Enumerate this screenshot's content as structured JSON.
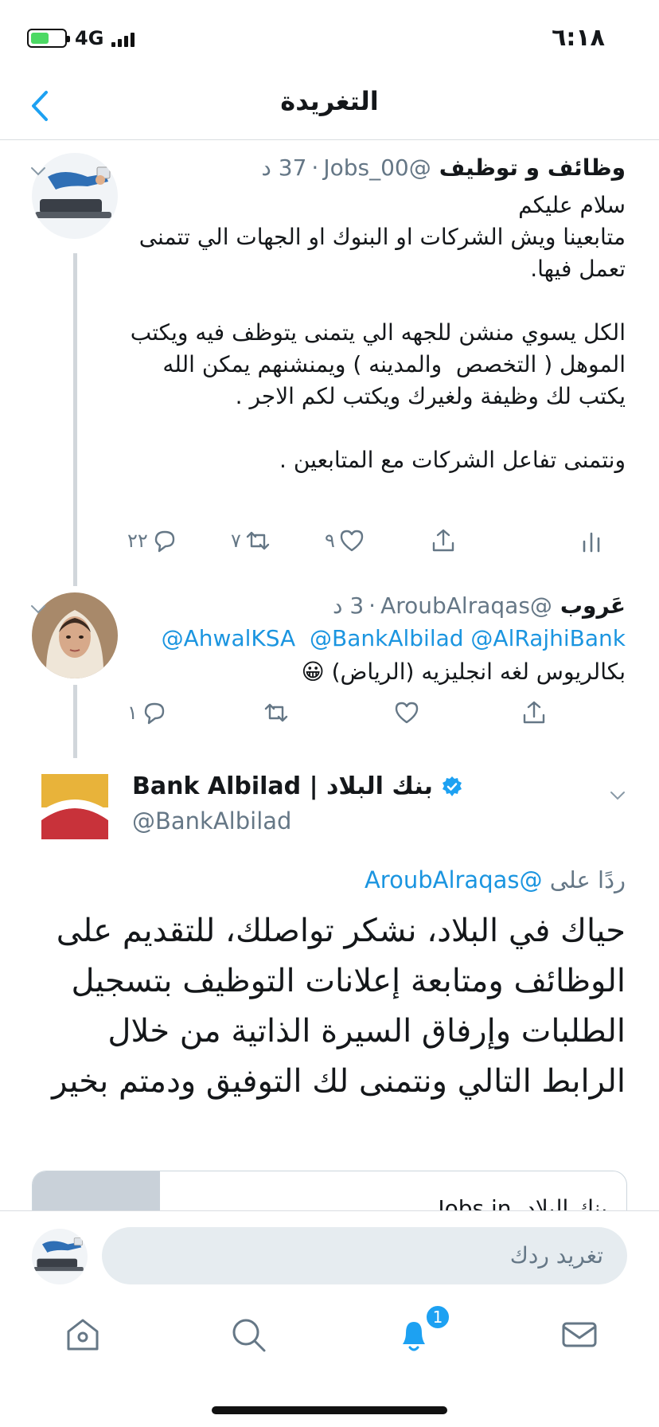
{
  "status_bar": {
    "time": "٦:١٨",
    "network": "4G",
    "battery_level": 0.55,
    "battery_color": "#4cd964"
  },
  "nav": {
    "title": "التغريدة",
    "back_icon": "chevron-left-icon",
    "accent": "#1da1f2"
  },
  "thread": [
    {
      "name": "وظائف و توظيف",
      "handle": "@Jobs_00",
      "time": "37 د",
      "text": "سلام عليكم\nمتابعينا ويش الشركات او البنوك او الجهات الي تتمنى تعمل فيها.\n\nالكل يسوي منشن للجهه الي يتمنى يتوظف فيه ويكتب الموهل ( التخصص  والمدينه ) ويمنشنهم يمكن الله يكتب لك وظيفة ولغيرك ويكتب لكم الاجر .\n\nونتمنى تفاعل الشركات مع المتابعين .",
      "replies": "٢٢",
      "retweets": "٧",
      "likes": "٩"
    },
    {
      "name": "عَروب",
      "handle": "@AroubAlraqas",
      "time": "3 د",
      "mentions": "@AhwalKSA  @BankAlbilad @AlRajhiBank",
      "text": "بكالريوس لغه انجليزيه (الرياض) 😀",
      "replies": "١",
      "retweets": "",
      "likes": ""
    }
  ],
  "main_tweet": {
    "name": "Bank Albilad | بنك البلاد",
    "handle": "@BankAlbilad",
    "reply_prefix": "ردًا على",
    "reply_to": "@AroubAlraqas",
    "text": "حياك في البلاد، نشكر تواصلك، للتقديم على الوظائف ومتابعة إعلانات التوظيف بتسجيل الطلبات وإرفاق السيرة الذاتية من خلال الرابط التالي ونتمنى لك التوفيق ودمتم بخير",
    "link_card_title": "بنك البلاد .Jobs in",
    "logo_colors": {
      "top": "#e8b33a",
      "bottom": "#c8323a"
    }
  },
  "reply_bar": {
    "placeholder": "تغريد ردك"
  },
  "tab_bar": {
    "tabs": [
      "home-icon",
      "search-icon",
      "notifications-icon",
      "messages-icon"
    ],
    "active": "notifications-icon",
    "notification_badge": "1"
  }
}
